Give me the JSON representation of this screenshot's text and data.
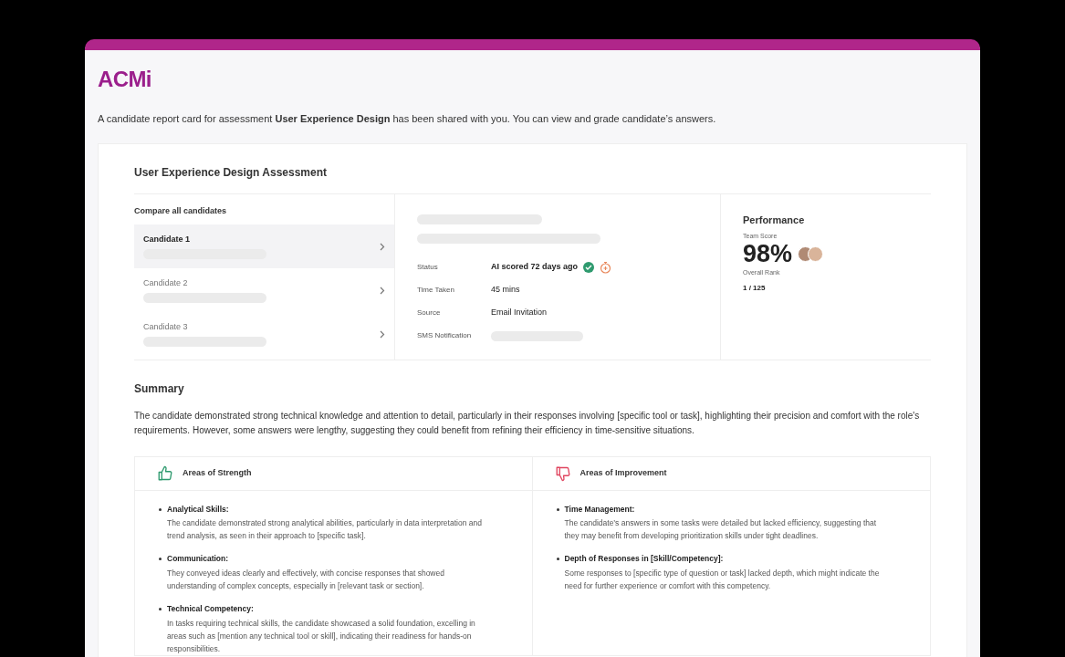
{
  "logo": "ACMi",
  "intro": "A candidate report card for assessment **User Experience Design** has been shared with you. You can view and grade candidate’s answers.",
  "assessment_title": "User Experience Design Assessment",
  "compare": {
    "title": "Compare all candidates",
    "candidates": [
      {
        "name": "Candidate 1",
        "selected": true
      },
      {
        "name": "Candidate 2",
        "selected": false
      },
      {
        "name": "Candidate 3",
        "selected": false
      }
    ]
  },
  "details": [
    {
      "label": "Status",
      "kind": "status",
      "value": "AI scored 72 days ago"
    },
    {
      "label": "Time Taken",
      "kind": "text",
      "value": "45 mins"
    },
    {
      "label": "Source",
      "kind": "text",
      "value": "Email Invitation"
    },
    {
      "label": "SMS Notification",
      "kind": "placeholder"
    }
  ],
  "performance": {
    "title": "Performance",
    "score_label": "Team Score",
    "score": "98%",
    "rank_label": "Overall Rank",
    "rank": "1 / 125"
  },
  "summary": {
    "title": "Summary",
    "text": "The candidate demonstrated strong technical knowledge and attention to detail, particularly in their responses involving [specific tool or task], highlighting their precision and comfort with the role's requirements. However, some answers were lengthy, suggesting they could benefit from refining their efficiency in time-sensitive situations."
  },
  "areas": [
    {
      "kind": "strength",
      "title": "Areas of Strength",
      "items": [
        {
          "heading": "Analytical Skills:",
          "text": "The candidate demonstrated strong analytical abilities, particularly in data interpretation and trend analysis, as seen in their approach to [specific task]."
        },
        {
          "heading": "Communication:",
          "text": "They conveyed ideas clearly and effectively, with concise responses that showed understanding of complex concepts, especially in [relevant task or section]."
        },
        {
          "heading": "Technical Competency:",
          "text": "In tasks requiring technical skills, the candidate showcased a solid foundation, excelling in areas such as [mention any technical tool or skill], indicating their readiness for hands-on responsibilities."
        }
      ]
    },
    {
      "kind": "improvement",
      "title": "Areas of Improvement",
      "items": [
        {
          "heading": "Time Management:",
          "text": "The candidate’s answers in some tasks were detailed but lacked efficiency, suggesting that they may benefit from developing prioritization skills under tight deadlines."
        },
        {
          "heading": "Depth of Responses in [Skill/Competency]:",
          "text": "Some responses to [specific type of question or task] lacked depth, which might indicate the need for further experience or comfort with this competency."
        }
      ]
    }
  ]
}
